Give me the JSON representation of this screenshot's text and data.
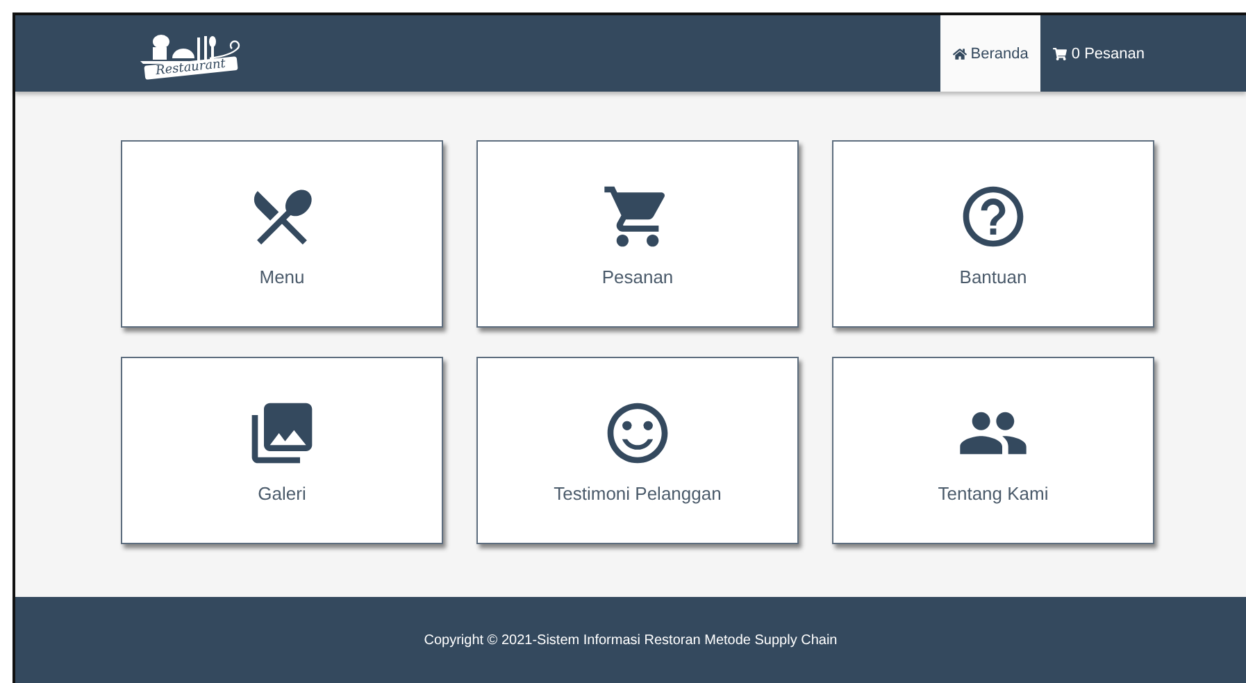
{
  "header": {
    "logo_text": "Restaurant",
    "nav": [
      {
        "label": "Beranda",
        "selected": true
      },
      {
        "label": "0 Pesanan",
        "selected": false
      }
    ]
  },
  "cards": [
    {
      "label": "Menu"
    },
    {
      "label": "Pesanan"
    },
    {
      "label": "Bantuan"
    },
    {
      "label": "Galeri"
    },
    {
      "label": "Testimoni Pelanggan"
    },
    {
      "label": "Tentang Kami"
    }
  ],
  "footer": {
    "text": "Copyright © 2021-Sistem Informasi Restoran Metode Supply Chain"
  }
}
